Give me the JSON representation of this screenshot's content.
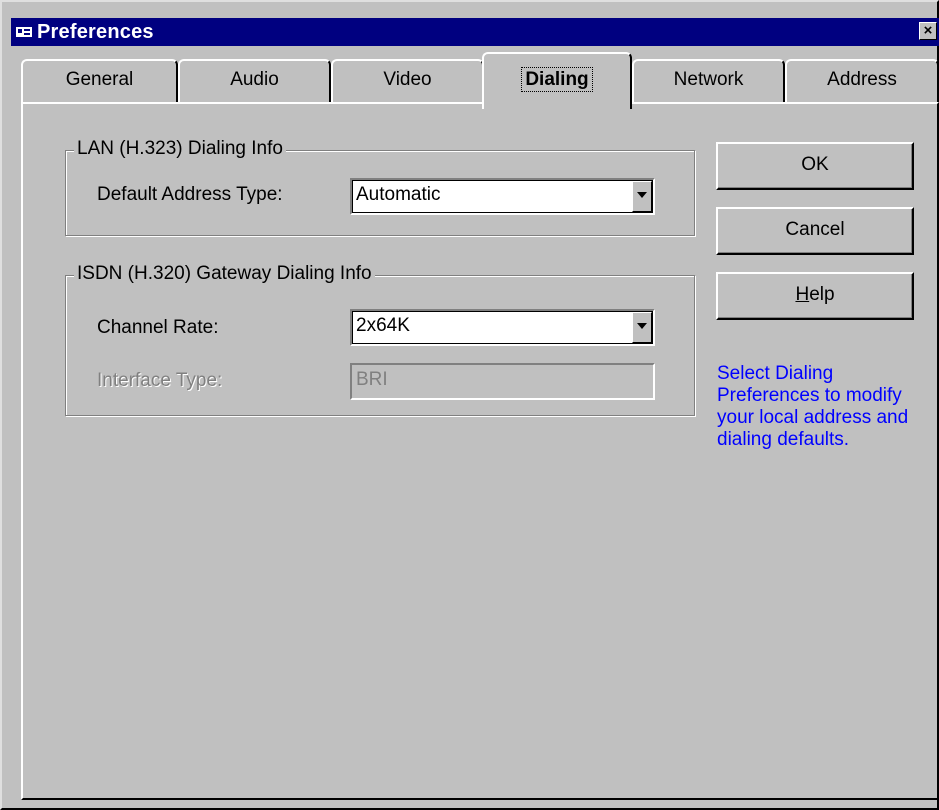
{
  "window": {
    "title": "Preferences",
    "close_symbol": "×"
  },
  "tabs": [
    {
      "label": "General"
    },
    {
      "label": "Audio"
    },
    {
      "label": "Video"
    },
    {
      "label": "Dialing",
      "active": true
    },
    {
      "label": "Network"
    },
    {
      "label": "Address"
    }
  ],
  "lan_group": {
    "title": "LAN (H.323) Dialing Info",
    "default_address_type_label": "Default Address Type:",
    "default_address_type_value": "Automatic"
  },
  "isdn_group": {
    "title": "ISDN (H.320) Gateway Dialing Info",
    "channel_rate_label": "Channel Rate:",
    "channel_rate_value": "2x64K",
    "interface_type_label": "Interface Type:",
    "interface_type_value": "BRI"
  },
  "buttons": {
    "ok": "OK",
    "cancel": "Cancel",
    "help_first": "H",
    "help_rest": "elp"
  },
  "hint_text": "Select Dialing Preferences to modify your local address and dialing defaults.",
  "colors": {
    "titlebar": "#000080",
    "face": "#c0c0c0",
    "hint": "#0000ff"
  },
  "icons": {
    "title": "window-app-icon",
    "dropdown": "chevron-down-icon"
  }
}
